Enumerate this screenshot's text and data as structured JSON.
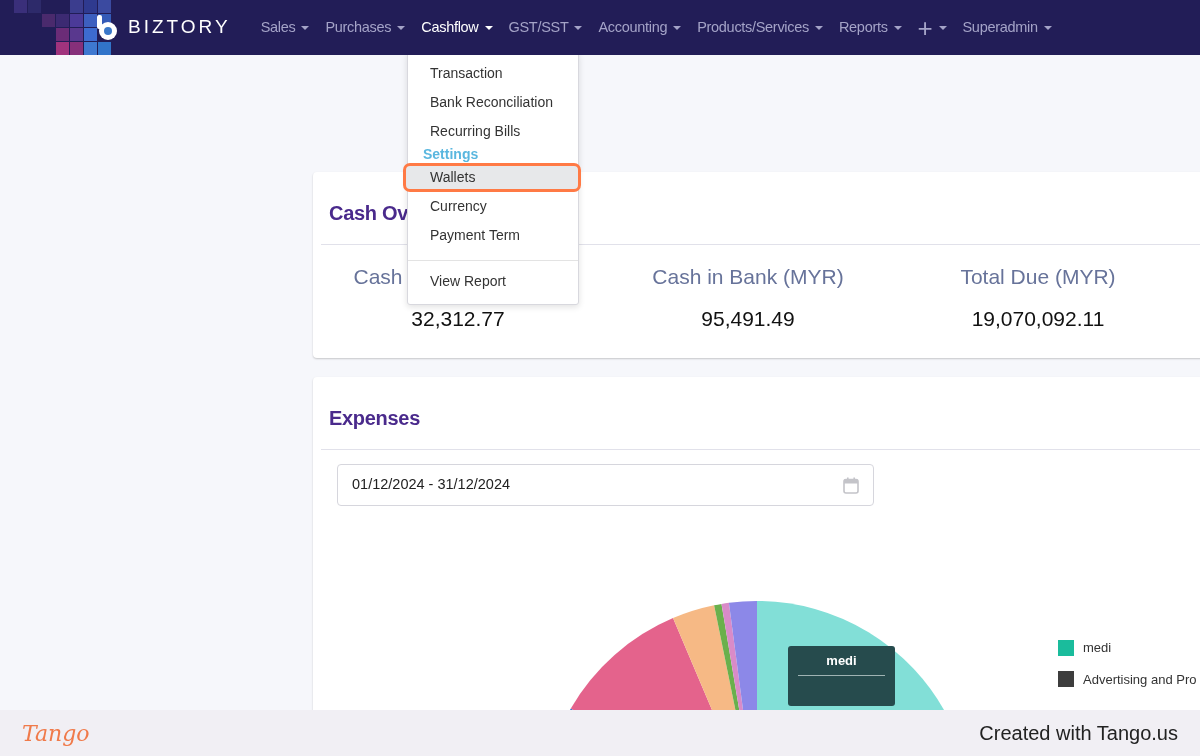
{
  "navbar": {
    "brand": "BIZTORY",
    "items": [
      {
        "label": "Sales",
        "selected": false
      },
      {
        "label": "Purchases",
        "selected": false
      },
      {
        "label": "Cashflow",
        "selected": true
      },
      {
        "label": "GST/SST",
        "selected": false
      },
      {
        "label": "Accounting",
        "selected": false
      },
      {
        "label": "Products/Services",
        "selected": false
      },
      {
        "label": "Reports",
        "selected": false
      },
      {
        "label": "+",
        "selected": false
      },
      {
        "label": "Superadmin",
        "selected": false
      }
    ]
  },
  "dropdown": {
    "items": [
      {
        "kind": "item",
        "label": "Transaction",
        "selected": false
      },
      {
        "kind": "item",
        "label": "Bank Reconciliation",
        "selected": false
      },
      {
        "kind": "item",
        "label": "Recurring Bills",
        "selected": false
      },
      {
        "kind": "header",
        "label": "Settings"
      },
      {
        "kind": "item",
        "label": "Wallets",
        "selected": true
      },
      {
        "kind": "item",
        "label": "Currency",
        "selected": false
      },
      {
        "kind": "item",
        "label": "Payment Term",
        "selected": false
      },
      {
        "kind": "divider"
      },
      {
        "kind": "item",
        "label": "View Report",
        "selected": false
      }
    ]
  },
  "cash_card": {
    "title": "Cash Ov",
    "stats": [
      {
        "label": "Cash",
        "value": "32,312.77"
      },
      {
        "label": "Cash in Bank (MYR)",
        "value": "95,491.49"
      },
      {
        "label": "Total Due (MYR)",
        "value": "19,070,092.11"
      }
    ]
  },
  "expenses_card": {
    "title": "Expenses",
    "date_range": "01/12/2024 - 31/12/2024",
    "tooltip_title": "medi",
    "legend": [
      {
        "label": "medi",
        "color": "#1abc9c"
      },
      {
        "label": "Advertising and Pro",
        "color": "#3d3d3d"
      }
    ]
  },
  "footer": {
    "brand": "Tango",
    "text": "Created with Tango.us"
  }
}
